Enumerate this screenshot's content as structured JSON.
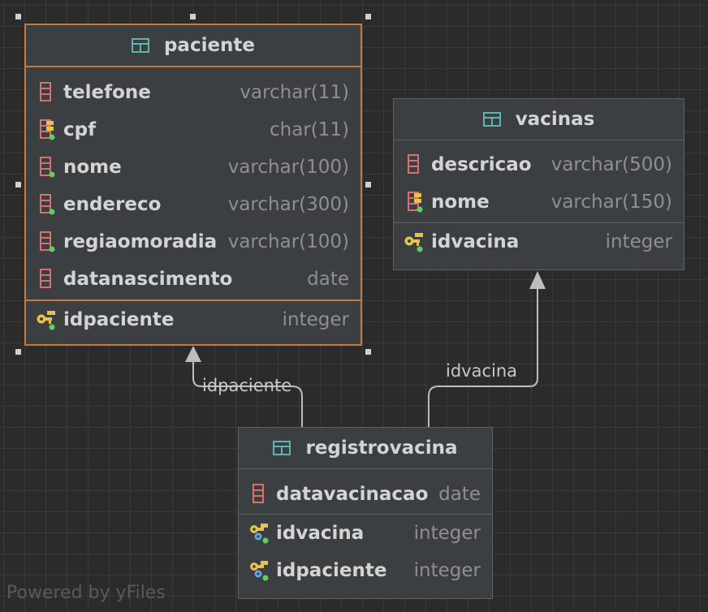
{
  "tables": {
    "paciente": {
      "name": "paciente",
      "columns": [
        {
          "name": "telefone",
          "type": "varchar(11)",
          "icon": "column-icon"
        },
        {
          "name": "cpf",
          "type": "char(11)",
          "icon": "index-column-icon"
        },
        {
          "name": "nome",
          "type": "varchar(100)",
          "icon": "not-null-column-icon"
        },
        {
          "name": "endereco",
          "type": "varchar(300)",
          "icon": "not-null-column-icon"
        },
        {
          "name": "regiaomoradia",
          "type": "varchar(100)",
          "icon": "not-null-column-icon"
        },
        {
          "name": "datanascimento",
          "type": "date",
          "icon": "column-icon"
        }
      ],
      "keys": [
        {
          "name": "idpaciente",
          "type": "integer",
          "icon": "primary-key-icon"
        }
      ]
    },
    "vacinas": {
      "name": "vacinas",
      "columns": [
        {
          "name": "descricao",
          "type": "varchar(500)",
          "icon": "column-icon"
        },
        {
          "name": "nome",
          "type": "varchar(150)",
          "icon": "index-column-icon"
        }
      ],
      "keys": [
        {
          "name": "idvacina",
          "type": "integer",
          "icon": "primary-key-icon"
        }
      ]
    },
    "registrovacina": {
      "name": "registrovacina",
      "columns": [
        {
          "name": "datavacinacao",
          "type": "date",
          "icon": "column-icon"
        }
      ],
      "keys": [
        {
          "name": "idvacina",
          "type": "integer",
          "icon": "foreign-key-icon"
        },
        {
          "name": "idpaciente",
          "type": "integer",
          "icon": "foreign-key-icon"
        }
      ]
    }
  },
  "edges": {
    "to_paciente": "idpaciente",
    "to_vacinas": "idvacina"
  },
  "watermark": "Powered by yFiles",
  "colors": {
    "background": "#2b2b2b",
    "selected_border": "#c77a3a",
    "column_icon": "#d9706b",
    "key_icon": "#e8c34a",
    "table_icon": "#5fb3b3",
    "not_null_dot": "#5fcf5f"
  }
}
